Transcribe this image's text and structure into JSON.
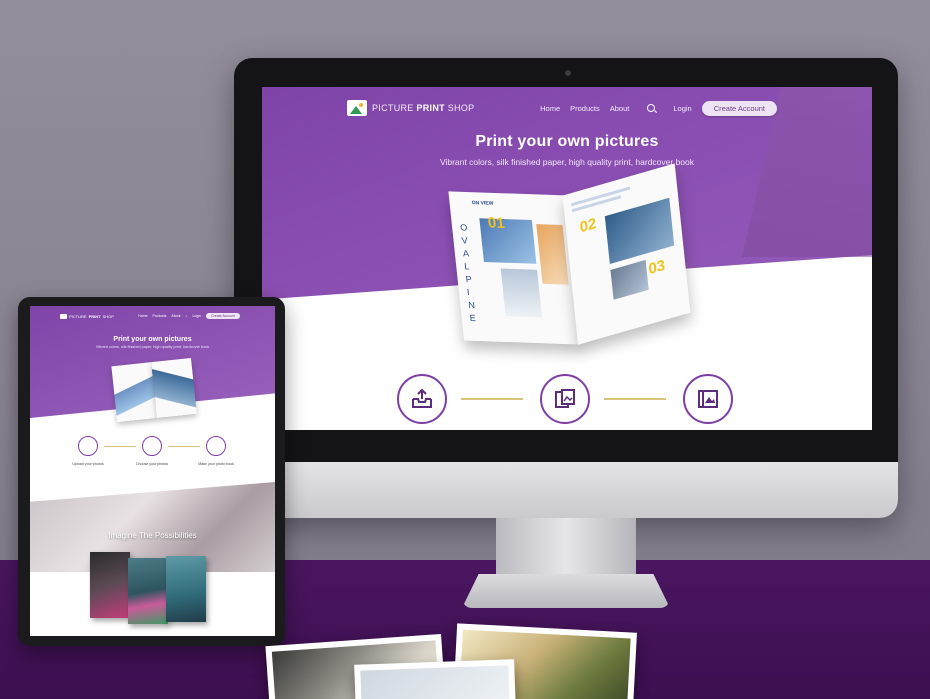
{
  "desktop": {
    "brand_light": "PICTURE",
    "brand_bold": "PRINT",
    "brand_tail": " SHOP",
    "nav": [
      "Home",
      "Products",
      "About"
    ],
    "login": "Login",
    "create_account": "Create Account",
    "hero_title": "Print your own pictures",
    "hero_subtitle": "Vibrant colors, silk finished paper, high quality print, hardcover book",
    "magazine": {
      "heading": "ON VIEW",
      "numbers": [
        "01",
        "02",
        "03"
      ],
      "letters": "OVALPINE"
    },
    "steps": [
      "upload-icon",
      "photos-icon",
      "book-icon"
    ]
  },
  "tablet": {
    "brand_light": "PICTURE",
    "brand_bold": "PRINT",
    "brand_tail": " SHOP",
    "nav": [
      "Home",
      "Products",
      "About"
    ],
    "login": "Login",
    "create_account": "Create Account",
    "hero_title": "Print your own pictures",
    "hero_subtitle": "Vibrant colors, silk finished paper, high quality print, hardcover book",
    "steps": [
      {
        "title": "Upload your photos"
      },
      {
        "title": "Choose your photos"
      },
      {
        "title": "Make your photo book"
      }
    ],
    "imagine_heading": "Imagine The Possibilities"
  },
  "colors": {
    "brand_purple": "#7f44a8",
    "accent_gold": "#f1c21a",
    "desk_purple": "#3c0f50"
  }
}
